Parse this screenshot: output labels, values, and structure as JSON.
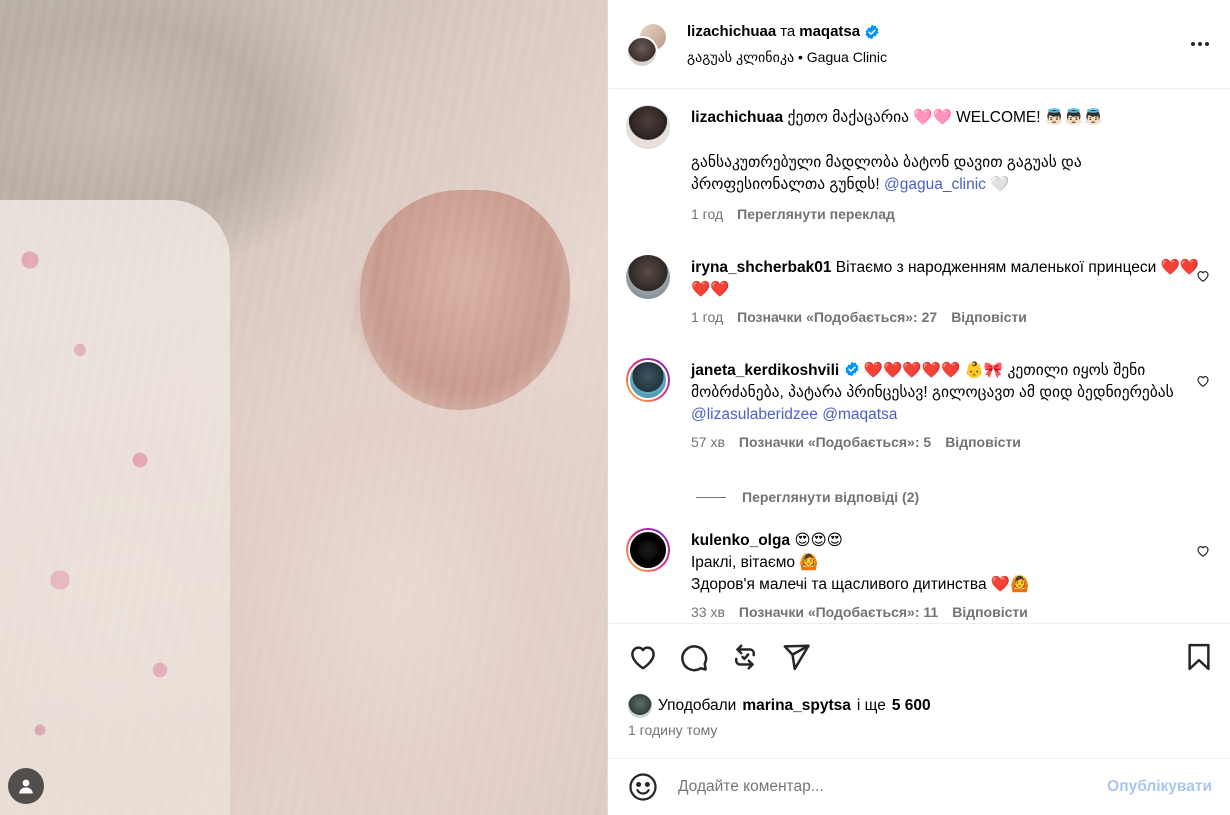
{
  "header": {
    "user1": "lizachichuaa",
    "joiner": "та",
    "user2": "maqatsa",
    "location": "გაგუას კლინიკა • Gagua Clinic"
  },
  "caption": {
    "username": "lizachichuaa",
    "line1": "ქეთო მაქაცარია 🩷🩷 WELCOME! 👼🏻👼🏻👼🏻",
    "line2_text": "განსაკუთრებული მადლობა ბატონ დავით გაგუას და პროფესიონალთა გუნდს! ",
    "mention": "@gagua_clinic",
    "tail": " 🤍",
    "time": "1 год",
    "translate": "Переглянути переклад"
  },
  "comments": [
    {
      "username": "iryna_shcherbak01",
      "text": "Вітаємо з народженням маленької принцеси ❤️❤️❤️❤️",
      "time": "1 год",
      "likes": "Позначки «Подобається»: 27",
      "reply": "Відповісти"
    },
    {
      "username": "janeta_kerdikoshvili",
      "text": " ❤️❤️❤️❤️❤️ 👶🎀 კეთილი იყოს შენი მობრძანება, პატარა პრინცესავ! გილოცავთ ამ დიდ ბედნიერებას ",
      "mention1": "@lizasulaberidzee",
      "mention2": "@maqatsa",
      "time": "57 хв",
      "likes": "Позначки «Подобається»: 5",
      "reply": "Відповісти"
    },
    {
      "username": "kulenko_olga",
      "line1": " 😍😍😍",
      "line2": "Іраклі, вітаємо 🙆",
      "line3": "Здоров'я малечі та щасливого дитинства ❤️🙆",
      "time": "33 хв",
      "likes": "Позначки «Подобається»: 11",
      "reply": "Відповісти"
    }
  ],
  "view_replies": "Переглянути відповіді (2)",
  "likes": {
    "prefix": "Уподобали",
    "user": "marina_spytsa",
    "middle": "і ще",
    "count": "5 600"
  },
  "post_time": "1 годину тому",
  "comment_input": {
    "placeholder": "Додайте коментар...",
    "post_label": "Опублікувати"
  },
  "colors": {
    "link": "#4a5fc9",
    "muted": "#737373",
    "post_button_disabled": "#a9c6f2",
    "verified": "#0095f6"
  }
}
